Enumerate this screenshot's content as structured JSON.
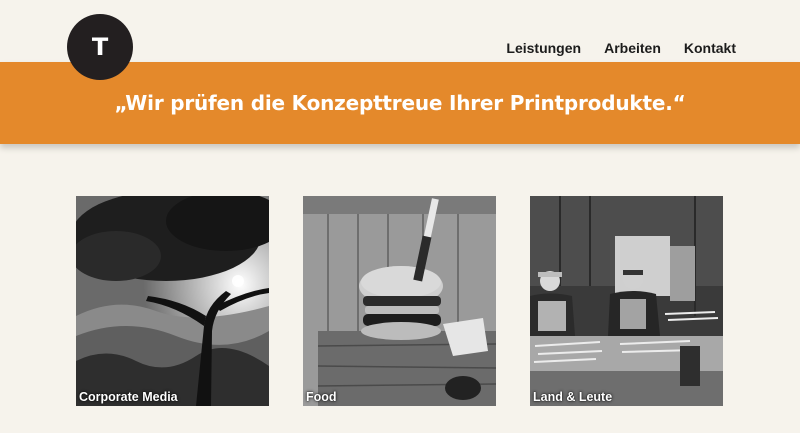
{
  "logo": {
    "letter": "T"
  },
  "nav": {
    "items": [
      {
        "label": "Leistungen"
      },
      {
        "label": "Arbeiten"
      },
      {
        "label": "Kontakt"
      }
    ]
  },
  "banner": {
    "quote": "„Wir prüfen die Konzepttreue Ihrer Printprodukte.“",
    "color": "#e4892b"
  },
  "tiles": [
    {
      "label": "Corporate Media",
      "image": "tree-landscape-photo"
    },
    {
      "label": "Food",
      "image": "burger-with-knife-photo"
    },
    {
      "label": "Land & Leute",
      "image": "asparagus-workers-photo"
    }
  ]
}
